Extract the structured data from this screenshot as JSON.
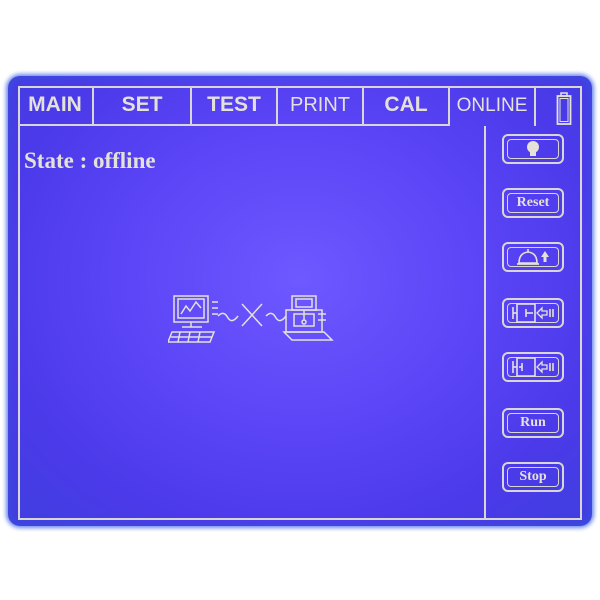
{
  "tabs": [
    {
      "label": "MAIN",
      "active": false
    },
    {
      "label": "SET",
      "active": false
    },
    {
      "label": "TEST",
      "active": false
    },
    {
      "label": "PRINT",
      "active": false
    },
    {
      "label": "CAL",
      "active": false
    },
    {
      "label": "ONLINE",
      "active": true
    }
  ],
  "state_text": "State : offline",
  "sidebar": {
    "light_icon": "bulb-icon",
    "reset_label": "Reset",
    "bell_icon": "bell-up-icon",
    "clamp_in_icon": "clamp-in-icon",
    "clamp_out_icon": "clamp-out-icon",
    "run_label": "Run",
    "stop_label": "Stop"
  },
  "status_icons": {
    "battery": "battery-icon",
    "connection": "pc-disconnected-instrument-icon"
  },
  "colors": {
    "screen": "#5a44f6",
    "lines": "#d9d6cf",
    "text": "#e4e1d9"
  }
}
